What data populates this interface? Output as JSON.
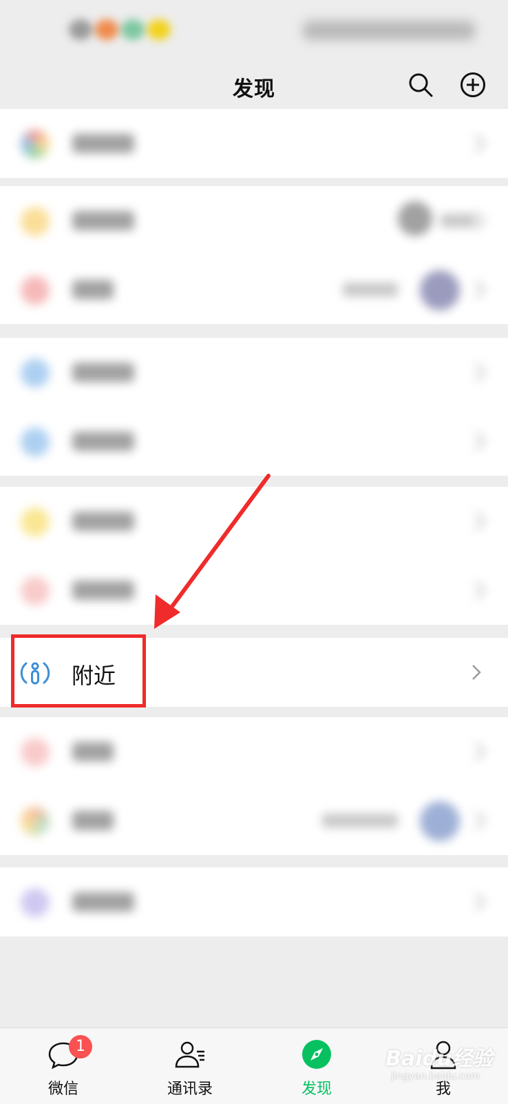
{
  "nav": {
    "title": "发现",
    "search_icon": "search-icon",
    "add_icon": "add-circle-icon"
  },
  "highlighted_item": {
    "label": "附近",
    "icon": "nearby-people-icon",
    "icon_color": "#3f8ed6"
  },
  "annotation": {
    "color": "#ef2b2b"
  },
  "tabbar": {
    "tabs": [
      {
        "label": "微信",
        "icon": "chat-bubble-icon",
        "badge": "1",
        "active": false
      },
      {
        "label": "通讯录",
        "icon": "contacts-icon",
        "active": false
      },
      {
        "label": "发现",
        "icon": "compass-icon",
        "active": true
      },
      {
        "label": "我",
        "icon": "person-icon",
        "active": false
      }
    ],
    "active_color": "#07c160",
    "inactive_color": "#111111",
    "badge_color": "#fa5151"
  },
  "watermark": {
    "brand": "Baidu经验",
    "url": "jingyan.baidu.com"
  }
}
